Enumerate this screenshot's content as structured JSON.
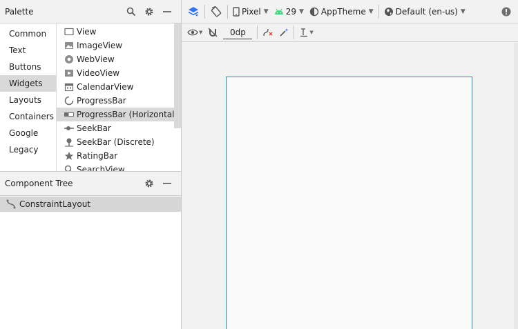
{
  "palette": {
    "title": "Palette",
    "categories": [
      {
        "label": "Common"
      },
      {
        "label": "Text"
      },
      {
        "label": "Buttons"
      },
      {
        "label": "Widgets",
        "selected": true
      },
      {
        "label": "Layouts"
      },
      {
        "label": "Containers"
      },
      {
        "label": "Google"
      },
      {
        "label": "Legacy"
      }
    ],
    "widgets": [
      {
        "label": "View",
        "icon": "view-icon"
      },
      {
        "label": "ImageView",
        "icon": "image-icon"
      },
      {
        "label": "WebView",
        "icon": "globe-icon"
      },
      {
        "label": "VideoView",
        "icon": "video-icon"
      },
      {
        "label": "CalendarView",
        "icon": "calendar-icon"
      },
      {
        "label": "ProgressBar",
        "icon": "progress-spinner-icon"
      },
      {
        "label": "ProgressBar (Horizontal)",
        "icon": "progress-horizontal-icon",
        "selected": true
      },
      {
        "label": "SeekBar",
        "icon": "seekbar-icon"
      },
      {
        "label": "SeekBar (Discrete)",
        "icon": "seekbar-discrete-icon"
      },
      {
        "label": "RatingBar",
        "icon": "star-icon"
      },
      {
        "label": "SearchView",
        "icon": "search-icon"
      }
    ]
  },
  "component_tree": {
    "title": "Component Tree",
    "root": "ConstraintLayout"
  },
  "toolbar": {
    "device": "Pixel",
    "api_level": "29",
    "theme": "AppTheme",
    "locale": "Default (en-us)",
    "default_margin": "0dp"
  },
  "colors": {
    "accent_blue": "#3574f0",
    "android_green": "#3ddc84",
    "blueprint_border": "#1a8fa5",
    "error_red": "#e0473f"
  }
}
